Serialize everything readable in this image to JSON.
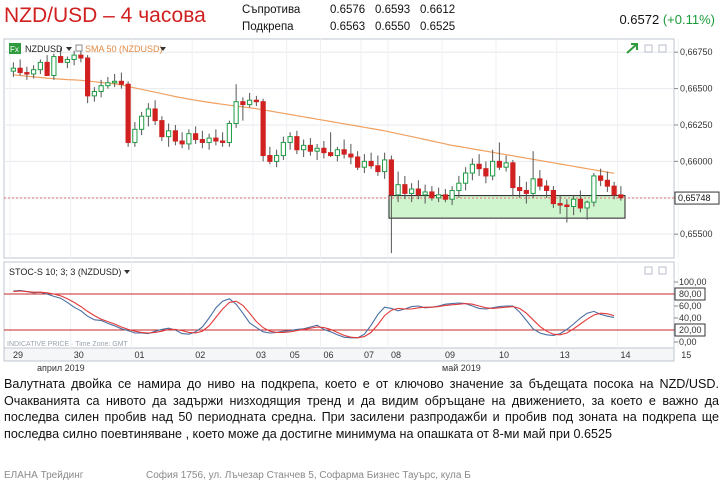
{
  "header": {
    "title": "NZD/USD – 4 часова",
    "resistance_label": "Съпротива",
    "resistance_levels": [
      "0.6576",
      "0.6593",
      "0.6612"
    ],
    "support_label": "Подкрепа",
    "support_levels": [
      "0.6563",
      "0.6550",
      "0.6525"
    ],
    "last_price": "0.6572",
    "change": "(+0.11%)"
  },
  "chart_data": [
    {
      "type": "candlestick",
      "symbol_label": "NZDUSD",
      "indicator_label": "SMA 50 (NZDUSD)",
      "badge": "Fx",
      "ylim": [
        0.6535,
        0.6682
      ],
      "y_ticks": [
        "0,66750",
        "0,66500",
        "0,66250",
        "0,66000",
        "0,65750",
        "0,65500"
      ],
      "y_tick_values": [
        0.6675,
        0.665,
        0.6625,
        0.66,
        0.6575,
        0.655
      ],
      "last_price_label": "0,65748",
      "last_price_value": 0.65748,
      "support_zone": [
        0.6561,
        0.65765
      ],
      "support_zone_start_index": 56,
      "ohlc": [
        [
          0.6662,
          0.6668,
          0.6658,
          0.6664
        ],
        [
          0.6664,
          0.667,
          0.6659,
          0.6661
        ],
        [
          0.6661,
          0.6665,
          0.6656,
          0.666
        ],
        [
          0.666,
          0.6666,
          0.6657,
          0.6663
        ],
        [
          0.6663,
          0.667,
          0.666,
          0.6668
        ],
        [
          0.6668,
          0.6673,
          0.6664,
          0.6659
        ],
        [
          0.6659,
          0.6674,
          0.6656,
          0.6672
        ],
        [
          0.6672,
          0.6678,
          0.6669,
          0.6668
        ],
        [
          0.6668,
          0.6672,
          0.6664,
          0.667
        ],
        [
          0.667,
          0.6676,
          0.6666,
          0.6673
        ],
        [
          0.6673,
          0.6676,
          0.6668,
          0.6671
        ],
        [
          0.6671,
          0.6673,
          0.664,
          0.6645
        ],
        [
          0.6645,
          0.6651,
          0.6641,
          0.6648
        ],
        [
          0.6648,
          0.6656,
          0.6644,
          0.6652
        ],
        [
          0.6652,
          0.6658,
          0.665,
          0.6654
        ],
        [
          0.6654,
          0.666,
          0.6651,
          0.6655
        ],
        [
          0.6655,
          0.6661,
          0.665,
          0.6653
        ],
        [
          0.6653,
          0.6655,
          0.661,
          0.6613
        ],
        [
          0.6613,
          0.6627,
          0.661,
          0.6622
        ],
        [
          0.6622,
          0.6634,
          0.6618,
          0.6631
        ],
        [
          0.6631,
          0.664,
          0.6624,
          0.6636
        ],
        [
          0.6636,
          0.6642,
          0.6625,
          0.6628
        ],
        [
          0.6628,
          0.6631,
          0.6614,
          0.6617
        ],
        [
          0.6617,
          0.6626,
          0.661,
          0.6621
        ],
        [
          0.6621,
          0.6625,
          0.6611,
          0.6614
        ],
        [
          0.6614,
          0.662,
          0.6609,
          0.6612
        ],
        [
          0.6612,
          0.6622,
          0.6608,
          0.6619
        ],
        [
          0.6619,
          0.6624,
          0.6612,
          0.6615
        ],
        [
          0.6615,
          0.6621,
          0.6609,
          0.6613
        ],
        [
          0.6613,
          0.6619,
          0.6608,
          0.6616
        ],
        [
          0.6616,
          0.6622,
          0.6611,
          0.6614
        ],
        [
          0.6614,
          0.662,
          0.661,
          0.6613
        ],
        [
          0.6613,
          0.6628,
          0.661,
          0.6626
        ],
        [
          0.6626,
          0.6653,
          0.6623,
          0.6641
        ],
        [
          0.6641,
          0.6644,
          0.6628,
          0.6639
        ],
        [
          0.6639,
          0.6647,
          0.6637,
          0.6642
        ],
        [
          0.6642,
          0.6645,
          0.6638,
          0.6641
        ],
        [
          0.6641,
          0.6643,
          0.66,
          0.6604
        ],
        [
          0.6604,
          0.661,
          0.6598,
          0.66
        ],
        [
          0.66,
          0.6608,
          0.6596,
          0.6604
        ],
        [
          0.6604,
          0.6617,
          0.6601,
          0.6613
        ],
        [
          0.6613,
          0.662,
          0.6608,
          0.6617
        ],
        [
          0.6617,
          0.6621,
          0.6605,
          0.6608
        ],
        [
          0.6608,
          0.6615,
          0.6603,
          0.6611
        ],
        [
          0.6611,
          0.6616,
          0.6604,
          0.6607
        ],
        [
          0.6607,
          0.6612,
          0.6601,
          0.6609
        ],
        [
          0.6609,
          0.6614,
          0.6602,
          0.6606
        ],
        [
          0.6606,
          0.662,
          0.6603,
          0.6604
        ],
        [
          0.6604,
          0.661,
          0.66,
          0.6608
        ],
        [
          0.6608,
          0.6615,
          0.6602,
          0.6605
        ],
        [
          0.6605,
          0.6612,
          0.6598,
          0.6603
        ],
        [
          0.6603,
          0.6607,
          0.6594,
          0.6596
        ],
        [
          0.6596,
          0.6605,
          0.6592,
          0.66
        ],
        [
          0.66,
          0.6606,
          0.6595,
          0.6597
        ],
        [
          0.6597,
          0.6604,
          0.659,
          0.6593
        ],
        [
          0.6593,
          0.6606,
          0.6588,
          0.6601
        ],
        [
          0.6601,
          0.6604,
          0.6537,
          0.6577
        ],
        [
          0.6577,
          0.6593,
          0.6572,
          0.6584
        ],
        [
          0.6584,
          0.659,
          0.6574,
          0.6578
        ],
        [
          0.6578,
          0.6585,
          0.6572,
          0.6581
        ],
        [
          0.6581,
          0.6587,
          0.6574,
          0.6577
        ],
        [
          0.6577,
          0.6584,
          0.6571,
          0.6579
        ],
        [
          0.6579,
          0.6583,
          0.6573,
          0.6575
        ],
        [
          0.6575,
          0.6582,
          0.6572,
          0.6577
        ],
        [
          0.6577,
          0.6581,
          0.6572,
          0.6574
        ],
        [
          0.6574,
          0.6583,
          0.657,
          0.658
        ],
        [
          0.658,
          0.659,
          0.6575,
          0.6585
        ],
        [
          0.6585,
          0.6596,
          0.658,
          0.6592
        ],
        [
          0.6592,
          0.6602,
          0.6587,
          0.6598
        ],
        [
          0.6598,
          0.6605,
          0.659,
          0.6595
        ],
        [
          0.6595,
          0.66,
          0.6585,
          0.659
        ],
        [
          0.659,
          0.6608,
          0.6587,
          0.66
        ],
        [
          0.66,
          0.6613,
          0.6594,
          0.6596
        ],
        [
          0.6596,
          0.6604,
          0.6593,
          0.6599
        ],
        [
          0.6599,
          0.6601,
          0.6576,
          0.6582
        ],
        [
          0.6582,
          0.659,
          0.6575,
          0.658
        ],
        [
          0.658,
          0.6586,
          0.6571,
          0.6578
        ],
        [
          0.6578,
          0.6607,
          0.6575,
          0.6588
        ],
        [
          0.6588,
          0.6594,
          0.658,
          0.6583
        ],
        [
          0.6583,
          0.6587,
          0.6575,
          0.658
        ],
        [
          0.658,
          0.6583,
          0.6568,
          0.6571
        ],
        [
          0.6571,
          0.6577,
          0.6564,
          0.657
        ],
        [
          0.657,
          0.6574,
          0.6558,
          0.6569
        ],
        [
          0.6569,
          0.6577,
          0.6563,
          0.6574
        ],
        [
          0.6574,
          0.658,
          0.6565,
          0.6568
        ],
        [
          0.6568,
          0.6573,
          0.656,
          0.6572
        ],
        [
          0.6572,
          0.6592,
          0.6569,
          0.659
        ],
        [
          0.659,
          0.6595,
          0.6583,
          0.6587
        ],
        [
          0.6587,
          0.6593,
          0.6579,
          0.6583
        ],
        [
          0.6583,
          0.6586,
          0.6574,
          0.6577
        ],
        [
          0.6577,
          0.6583,
          0.6573,
          0.6575
        ]
      ],
      "sma50": [
        0.66595,
        0.6659,
        0.66585,
        0.6658,
        0.66576,
        0.66572,
        0.66568,
        0.66565,
        0.66562,
        0.6656,
        0.66557,
        0.66552,
        0.66547,
        0.66542,
        0.66537,
        0.66532,
        0.66525,
        0.66515,
        0.66505,
        0.66495,
        0.66485,
        0.66475,
        0.66465,
        0.66455,
        0.66445,
        0.66436,
        0.66428,
        0.6642,
        0.66412,
        0.66405,
        0.66398,
        0.66392,
        0.66386,
        0.6638,
        0.66374,
        0.66368,
        0.66362,
        0.66354,
        0.66346,
        0.66338,
        0.6633,
        0.66322,
        0.66314,
        0.66306,
        0.66298,
        0.6629,
        0.66282,
        0.66274,
        0.66266,
        0.66258,
        0.6625,
        0.66242,
        0.66234,
        0.66226,
        0.66218,
        0.6621,
        0.662,
        0.6619,
        0.6618,
        0.6617,
        0.6616,
        0.6615,
        0.6614,
        0.6613,
        0.6612,
        0.6611,
        0.66102,
        0.66094,
        0.66086,
        0.66078,
        0.6607,
        0.66062,
        0.66054,
        0.66046,
        0.66038,
        0.6603,
        0.66022,
        0.66014,
        0.66006,
        0.65998,
        0.6599,
        0.65982,
        0.65974,
        0.65966,
        0.65958,
        0.6595,
        0.65942,
        0.65934,
        0.65926,
        0.65918
      ]
    },
    {
      "type": "line",
      "indicator_label": "STOC-S 10; 3; 3 (NZDUSD)",
      "ylim": [
        0,
        100
      ],
      "y_ticks": [
        "100,00",
        "80,00",
        "60,00",
        "40,00",
        "20,00",
        "0,00"
      ],
      "y_tick_values": [
        100,
        80,
        60,
        40,
        20,
        0
      ],
      "levels": [
        80,
        20
      ],
      "series": [
        {
          "values": [
            85,
            86,
            84,
            82,
            83,
            80,
            76,
            73,
            66,
            58,
            52,
            43,
            37,
            36,
            31,
            27,
            22,
            19,
            15,
            15,
            14,
            18,
            21,
            23,
            20,
            14,
            13,
            17,
            25,
            40,
            57,
            68,
            72,
            63,
            48,
            32,
            24,
            17,
            15,
            16,
            18,
            19,
            21,
            22,
            25,
            28,
            21,
            17,
            12,
            8,
            7,
            7,
            13,
            28,
            46,
            58,
            56,
            52,
            55,
            59,
            60,
            57,
            58,
            60,
            63,
            64,
            65,
            64,
            60,
            56,
            55,
            57,
            59,
            60,
            60,
            50,
            36,
            22,
            15,
            12,
            11,
            14,
            21,
            30,
            40,
            48,
            51,
            46,
            43,
            41
          ]
        },
        {
          "values": [
            84,
            85,
            84,
            83,
            83,
            82,
            80,
            77,
            72,
            66,
            59,
            51,
            44,
            38,
            34,
            30,
            25,
            21,
            18,
            16,
            15,
            16,
            18,
            21,
            21,
            19,
            16,
            15,
            18,
            27,
            41,
            55,
            66,
            68,
            61,
            48,
            34,
            24,
            18,
            16,
            16,
            17,
            19,
            21,
            23,
            25,
            24,
            21,
            16,
            11,
            8,
            7,
            9,
            16,
            29,
            44,
            53,
            56,
            55,
            55,
            57,
            58,
            58,
            59,
            61,
            62,
            63,
            64,
            63,
            60,
            57,
            56,
            57,
            58,
            59,
            56,
            48,
            37,
            26,
            18,
            13,
            12,
            15,
            22,
            30,
            38,
            45,
            48,
            47,
            44
          ]
        }
      ]
    }
  ],
  "x_axis": {
    "day_labels": [
      "29",
      "30",
      "01",
      "02",
      "03",
      "05",
      "06",
      "07",
      "08",
      "09",
      "10",
      "13",
      "14",
      "15"
    ],
    "day_indices": [
      0,
      9,
      18,
      27,
      36,
      41,
      46,
      52,
      56,
      64,
      72,
      81,
      90,
      99
    ],
    "month_labels": [
      {
        "label": "април 2019",
        "index": 4
      },
      {
        "label": "май 2019",
        "index": 64
      }
    ],
    "watermark": "INDICATIVE PRICE · Time Zone: GMT"
  },
  "colors": {
    "up": "#1f9d45",
    "down": "#d02020",
    "sma": "#f0a060",
    "stoch_k": "#4a6fa0",
    "stoch_d": "#e23a3a",
    "zone_fill": "#cff5cf",
    "zone_border": "#222222"
  },
  "description": "Валутната двойка се намира до ниво на подкрепа, което е от ключово значение за бъдещата посока на NZD/USD. Очакванията са нивото да задържи низходящия тренд и да видим обръщане на движението, за което е важно да последва силен пробив над 50 периодната средна. При засилени разпродажби и пробив под зоната на подкрепа ще последва силно поевтиняване , което може да достигне минимума на опашката от 8-ми май при 0.6525",
  "footer": {
    "company": "ЕЛАНА Трейдинг",
    "address": "София 1756, ул. Лъчезар Станчев 5, Софарма Бизнес Тауърс, кула Б"
  }
}
